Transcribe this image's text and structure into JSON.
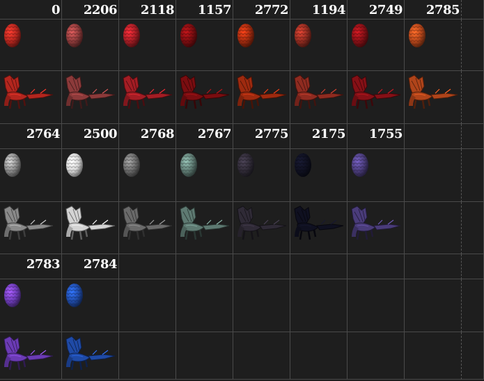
{
  "colors": {
    "background": "#1e1e1e",
    "grid_line": "#4a4a4a",
    "number_text": "#ffffff"
  },
  "groups": [
    {
      "items": [
        {
          "id": "0",
          "color": "#b3261e",
          "egg_icon": "red-dragon-egg-icon",
          "dragon_icon": "red-dragon-icon"
        },
        {
          "id": "2206",
          "color": "#8c3a3a",
          "egg_icon": "dull-red-egg-icon",
          "dragon_icon": "dull-red-dragon-icon"
        },
        {
          "id": "2118",
          "color": "#a31d24",
          "egg_icon": "crimson-egg-icon",
          "dragon_icon": "crimson-dragon-icon"
        },
        {
          "id": "1157",
          "color": "#7a0d10",
          "egg_icon": "dark-red-egg-icon",
          "dragon_icon": "dark-red-dragon-icon"
        },
        {
          "id": "2772",
          "color": "#9e2a0f",
          "egg_icon": "ember-egg-icon",
          "dragon_icon": "ember-dragon-icon"
        },
        {
          "id": "1194",
          "color": "#8f2b20",
          "egg_icon": "rust-red-egg-icon",
          "dragon_icon": "rust-red-dragon-icon"
        },
        {
          "id": "2749",
          "color": "#851016",
          "egg_icon": "blood-red-egg-icon",
          "dragon_icon": "blood-red-dragon-icon"
        },
        {
          "id": "2785",
          "color": "#b0441a",
          "egg_icon": "orange-red-egg-icon",
          "dragon_icon": "orange-red-dragon-icon"
        }
      ]
    },
    {
      "items": [
        {
          "id": "2764",
          "color": "#8a8a8a",
          "egg_icon": "grey-egg-icon",
          "dragon_icon": "grey-dragon-icon"
        },
        {
          "id": "2500",
          "color": "#d4d4d4",
          "egg_icon": "white-egg-icon",
          "dragon_icon": "white-dragon-icon"
        },
        {
          "id": "2768",
          "color": "#6a6a6a",
          "egg_icon": "dark-grey-egg-icon",
          "dragon_icon": "olive-dragon-icon"
        },
        {
          "id": "2767",
          "color": "#5e7a72",
          "egg_icon": "teal-grey-egg-icon",
          "dragon_icon": "teal-dragon-icon"
        },
        {
          "id": "2775",
          "color": "#2f2a36",
          "egg_icon": "shadow-egg-icon",
          "dragon_icon": "shadow-dragon-icon"
        },
        {
          "id": "2175",
          "color": "#0f1020",
          "egg_icon": "black-egg-icon",
          "dragon_icon": "black-dragon-icon"
        },
        {
          "id": "1755",
          "color": "#4a3c7a",
          "egg_icon": "dusk-purple-egg-icon",
          "dragon_icon": "dusk-purple-dragon-icon"
        }
      ]
    },
    {
      "items": [
        {
          "id": "2783",
          "color": "#6b3bb5",
          "egg_icon": "purple-egg-icon",
          "dragon_icon": "purple-dragon-icon"
        },
        {
          "id": "2784",
          "color": "#1f4aa6",
          "egg_icon": "blue-egg-icon",
          "dragon_icon": "blue-dragon-icon"
        }
      ]
    }
  ]
}
